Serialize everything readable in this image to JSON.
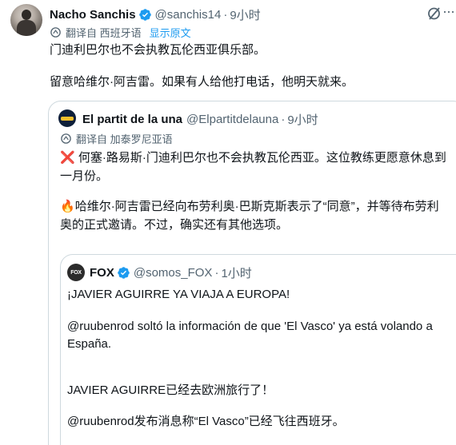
{
  "tweet": {
    "author_name": "Nacho Sanchis",
    "handle": "@sanchis14",
    "time": "9小时",
    "translated_from": "翻译自 西班牙语",
    "show_original": "显示原文",
    "line1": "门迪利巴尔也不会执教瓦伦西亚俱乐部。",
    "line2": "留意哈维尔·阿吉雷。如果有人给他打电话，他明天就来。"
  },
  "quote1": {
    "author_name": "El partit de la una",
    "handle": "@Elpartitdelauna",
    "time": "9小时",
    "translated_from": "翻译自 加泰罗尼亚语",
    "line1_emoji": "❌",
    "line1": "何塞·路易斯·门迪利巴尔也不会执教瓦伦西亚。这位教练更愿意休息到",
    "line2": "一月份。",
    "line3_emoji": "🔥",
    "line3": "哈维尔·阿吉雷已经向布劳利奥·巴斯克斯表示了“同意”，并等待布劳利",
    "line4": "奥的正式邀请。不过，确实还有其他选项。"
  },
  "quote2": {
    "author_name": "FOX",
    "logo_text": "FOX",
    "handle": "@somos_FOX",
    "time": "1小时",
    "line1": "¡JAVIER AGUIRRE YA VIAJA A EUROPA!",
    "line2": "@ruubenrod soltó la información de que 'El Vasco' ya está volando a",
    "line3": "España.",
    "line4": "JAVIER AGUIRRE已经去欧洲旅行了！",
    "line5": "@ruubenrod发布消息称“El Vasco”已经飞往西班牙。"
  },
  "colors": {
    "text": "#0f1419",
    "muted": "#536471",
    "accent": "#1d9bf0",
    "border": "#cfd9de"
  },
  "icons": [
    "avatar",
    "verified-badge-icon",
    "grok-icon",
    "more-options-icon",
    "translate-icon",
    "cross-mark-icon",
    "fire-icon"
  ]
}
